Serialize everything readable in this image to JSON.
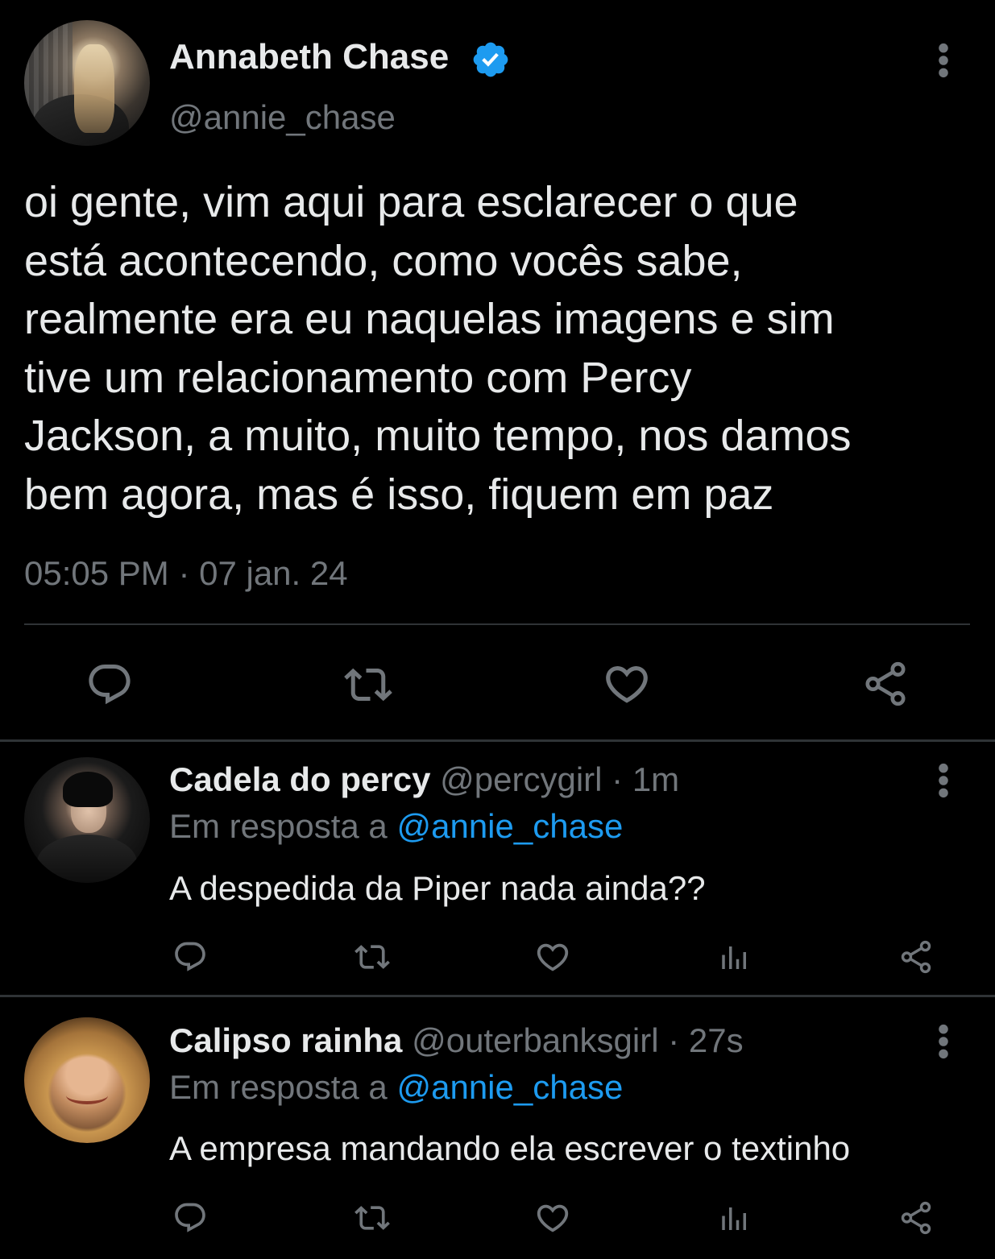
{
  "colors": {
    "background": "#000000",
    "text_primary": "#e7e9ea",
    "text_secondary": "#71767b",
    "accent": "#1d9bf0",
    "divider": "#2f3336"
  },
  "main_tweet": {
    "author_name": "Annabeth Chase",
    "verified": true,
    "handle": "@annie_chase",
    "text": "oi gente, vim aqui para esclarecer o que\nestá acontecendo, como vocês sabe,\nrealmente era eu naquelas imagens e sim\ntive um relacionamento com Percy\nJackson, a muito, muito tempo, nos damos\nbem agora, mas é isso, fiquem em paz",
    "timestamp": "05:05 PM · 07 jan. 24",
    "actions": [
      "reply-icon",
      "retweet-icon",
      "like-icon",
      "share-icon"
    ]
  },
  "replies": [
    {
      "author_name": "Cadela do percy",
      "handle": "@percygirl",
      "time": " · 1m",
      "reply_to_label": "Em resposta a ",
      "reply_to_handle": "@annie_chase",
      "text": "A despedida da Piper nada ainda??",
      "actions": [
        "reply-icon",
        "retweet-icon",
        "like-icon",
        "views-icon",
        "share-icon"
      ]
    },
    {
      "author_name": "Calipso rainha",
      "handle": "@outerbanksgirl",
      "time": " · 27s",
      "reply_to_label": "Em resposta a ",
      "reply_to_handle": "@annie_chase",
      "text": "A empresa mandando ela escrever o textinho",
      "actions": [
        "reply-icon",
        "retweet-icon",
        "like-icon",
        "views-icon",
        "share-icon"
      ]
    }
  ]
}
